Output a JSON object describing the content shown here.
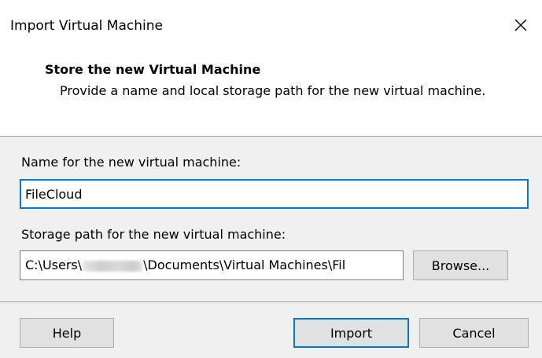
{
  "window": {
    "title": "Import Virtual Machine",
    "close_glyph": "close-icon"
  },
  "header": {
    "title": "Store the new Virtual Machine",
    "description": "Provide a name and local storage path for the new virtual machine."
  },
  "form": {
    "name_label": "Name for the new virtual machine:",
    "name_value": "FileCloud",
    "path_label": "Storage path for the new virtual machine:",
    "path_prefix": "C:\\Users\\",
    "path_suffix": "\\Documents\\Virtual Machines\\Fil",
    "browse_label": "Browse..."
  },
  "footer": {
    "help_label": "Help",
    "import_label": "Import",
    "cancel_label": "Cancel"
  },
  "colors": {
    "accent": "#0078d7",
    "panel": "#f0f0f0",
    "button": "#e1e1e1"
  }
}
